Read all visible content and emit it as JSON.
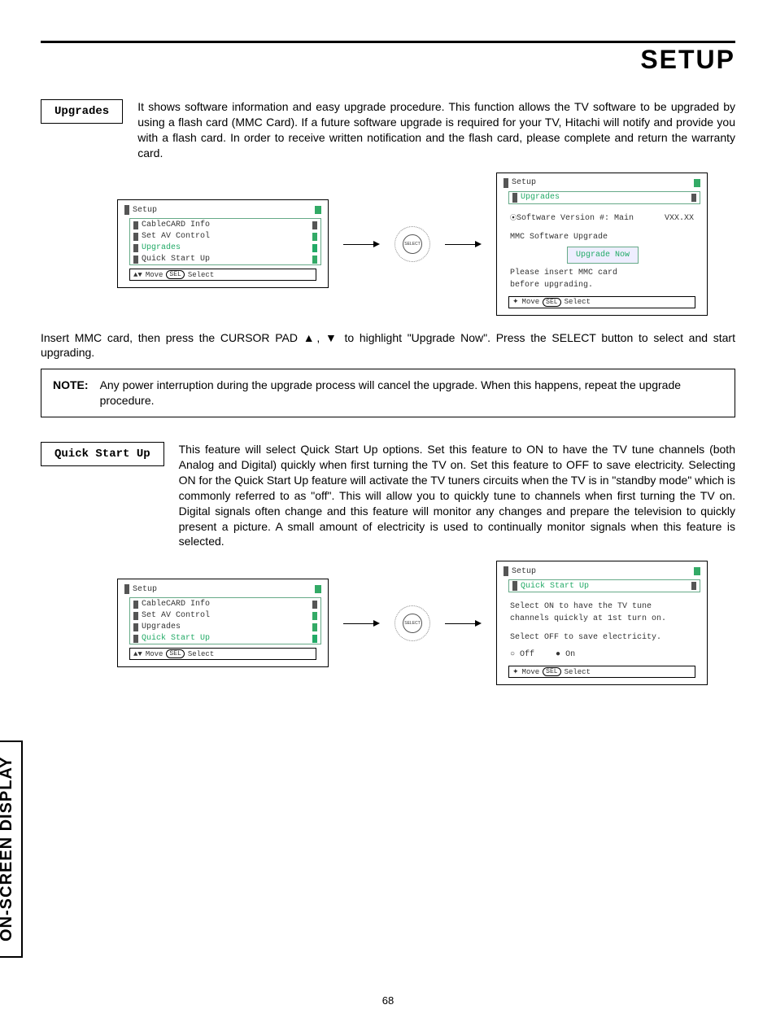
{
  "page_title": "SETUP",
  "page_number": "68",
  "side_tab": "ON-SCREEN DISPLAY",
  "upgrades": {
    "label": "Upgrades",
    "paragraph": "It shows software information and easy upgrade procedure.  This function allows the TV software to be upgraded by using a flash card (MMC Card).  If a future software upgrade is required for your TV, Hitachi will notify and provide you with a flash card.  In order to receive written notification and the flash card, please complete and return the warranty card.",
    "osd_left": {
      "title": "Setup",
      "items": [
        "CableCARD Info",
        "Set AV Control",
        "Upgrades",
        "Quick Start Up"
      ],
      "footer_move": "Move",
      "footer_sel": "SEL",
      "footer_select": "Select"
    },
    "select_label": "SELECT",
    "osd_right": {
      "title": "Setup",
      "subtitle": "Upgrades",
      "sw_label": "Software Version #: Main",
      "sw_value": "VXX.XX",
      "mmc_label": "MMC Software Upgrade",
      "button": "Upgrade Now",
      "msg1": "Please insert MMC card",
      "msg2": "before upgrading.",
      "footer_move": "Move",
      "footer_sel": "SEL",
      "footer_select": "Select"
    },
    "instruction": "Insert MMC card, then press the CURSOR PAD ▲, ▼ to highlight \"Upgrade Now\".  Press the SELECT button to select and start upgrading.",
    "note_label": "NOTE:",
    "note_text": "Any power interruption during the upgrade process will cancel the upgrade.  When this happens, repeat the upgrade procedure."
  },
  "quickstart": {
    "label": "Quick Start Up",
    "paragraph": "This feature will select Quick Start Up options.  Set this feature to ON to have the TV tune channels (both Analog and Digital) quickly when first turning the TV on.  Set this feature to OFF to save electricity.  Selecting ON for the Quick Start Up feature will activate the TV tuners circuits when the TV is in \"standby mode\" which is commonly referred to as \"off\".  This will allow you to quickly tune to channels when first turning the TV on.  Digital signals often change and this feature will monitor any changes and prepare the television to quickly present a picture.  A small amount of electricity is used to continually monitor signals when this feature is selected.",
    "osd_left": {
      "title": "Setup",
      "items": [
        "CableCARD Info",
        "Set AV Control",
        "Upgrades",
        "Quick Start Up"
      ],
      "footer_move": "Move",
      "footer_sel": "SEL",
      "footer_select": "Select"
    },
    "select_label": "SELECT",
    "osd_right": {
      "title": "Setup",
      "subtitle": "Quick Start Up",
      "line1": "Select ON to have the TV tune",
      "line2": "channels quickly at 1st turn on.",
      "line3": "Select OFF to save electricity.",
      "opt_off": "Off",
      "opt_on": "On",
      "footer_move": "Move",
      "footer_sel": "SEL",
      "footer_select": "Select"
    }
  }
}
